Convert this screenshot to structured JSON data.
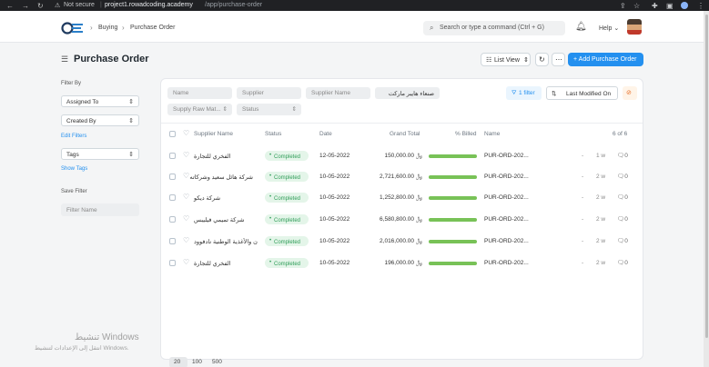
{
  "browser": {
    "security": "Not secure",
    "url_host": "project1.rowadcoding.academy",
    "url_path": "/app/purchase-order"
  },
  "navbar": {
    "breadcrumb": [
      "Buying",
      "Purchase Order"
    ],
    "search_placeholder": "Search or type a command (Ctrl + G)",
    "help_label": "Help"
  },
  "page": {
    "title": "Purchase Order",
    "list_view_label": "List View",
    "add_button_label": "+ Add Purchase Order"
  },
  "sidebar": {
    "filter_by_label": "Filter By",
    "assigned_to": "Assigned To",
    "created_by": "Created By",
    "edit_filters": "Edit Filters",
    "tags": "Tags",
    "show_tags": "Show Tags",
    "save_filter_label": "Save Filter",
    "filter_name_placeholder": "Filter Name"
  },
  "filters": {
    "name": "Name",
    "supplier": "Supplier",
    "supplier_name": "Supplier Name",
    "arabic_filter": "صنعاء هايبر ماركت",
    "supply_raw_materials": "Supply Raw Mat...",
    "status": "Status",
    "filter_count": "1 filter",
    "sort_label": "Last Modified On"
  },
  "table": {
    "headers": {
      "supplier_name": "Supplier Name",
      "status": "Status",
      "date": "Date",
      "grand_total": "Grand Total",
      "billed": "% Billed",
      "name": "Name",
      "count": "6 of 6"
    },
    "rows": [
      {
        "supplier": "الفخري للتجارة",
        "status": "Completed",
        "date": "12-05-2022",
        "total": "150,000.00 ﷼",
        "billed_pct": 100,
        "name": "PUR-ORD-202...",
        "dash": "-",
        "ago": "1 w",
        "comments": "0"
      },
      {
        "supplier": "شركة هائل سعيد وشركاته",
        "status": "Completed",
        "date": "10-05-2022",
        "total": "2,721,600.00 ﷼",
        "billed_pct": 100,
        "name": "PUR-ORD-202...",
        "dash": "-",
        "ago": "2 w",
        "comments": "0"
      },
      {
        "supplier": "شركة ديكو",
        "status": "Completed",
        "date": "10-05-2022",
        "total": "1,252,800.00 ﷼",
        "billed_pct": 100,
        "name": "PUR-ORD-202...",
        "dash": "-",
        "ago": "2 w",
        "comments": "0"
      },
      {
        "supplier": "شركة تميمي فيليبس",
        "status": "Completed",
        "date": "10-05-2022",
        "total": "6,580,800.00 ﷼",
        "billed_pct": 100,
        "name": "PUR-ORD-202...",
        "dash": "-",
        "ago": "2 w",
        "comments": "0"
      },
      {
        "supplier": "ن والأغذية الوطنية نادفوود",
        "status": "Completed",
        "date": "10-05-2022",
        "total": "2,016,000.00 ﷼",
        "billed_pct": 100,
        "name": "PUR-ORD-202...",
        "dash": "-",
        "ago": "2 w",
        "comments": "0"
      },
      {
        "supplier": "الفخري للتجارة",
        "status": "Completed",
        "date": "10-05-2022",
        "total": "196,000.00 ﷼",
        "billed_pct": 100,
        "name": "PUR-ORD-202...",
        "dash": "-",
        "ago": "2 w",
        "comments": "0"
      }
    ]
  },
  "pager": [
    "20",
    "100",
    "500"
  ],
  "watermark": {
    "line1": "تنشيط Windows",
    "line2": "انتقل إلى الإعدادات لتنشيط Windows."
  },
  "colors": {
    "primary": "#2490ef",
    "completed": "#2f9d58",
    "billed_bar": "#78c257"
  }
}
